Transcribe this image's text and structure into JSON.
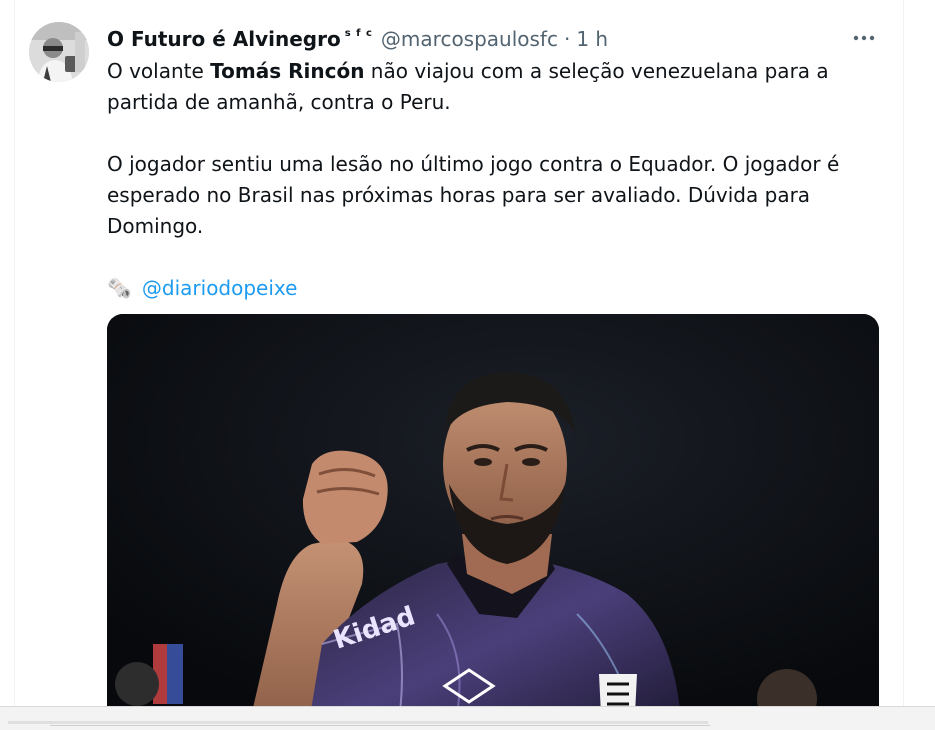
{
  "tweet": {
    "author": {
      "display_name": "O Futuro é Alvinegro",
      "badge": "s f c",
      "handle": "@marcospaulosfc",
      "separator": "·",
      "time": "1 h"
    },
    "more_icon": "more-horizontal-icon",
    "text": {
      "line1_pre": "O volante ",
      "line1_bold": "Tomás Rincón",
      "line1_post": " não viajou com a seleção venezuelana para a",
      "line2": "partida de amanhã, contra o Peru.",
      "para2_line1": "O jogador sentiu uma lesão no último jogo contra o Equador. O jogador é",
      "para2_line2": "esperado no  Brasil nas próximas horas para ser avaliado. Dúvida para",
      "para2_line3": "Domingo.",
      "newspaper_icon": "🗞️",
      "mention": "@diariodopeixe"
    },
    "media": {
      "logo_text": "umbro",
      "shirt_text": "Kidad"
    }
  },
  "colors": {
    "accent": "#1d9bf0",
    "text": "#0f1419",
    "muted": "#536471"
  }
}
